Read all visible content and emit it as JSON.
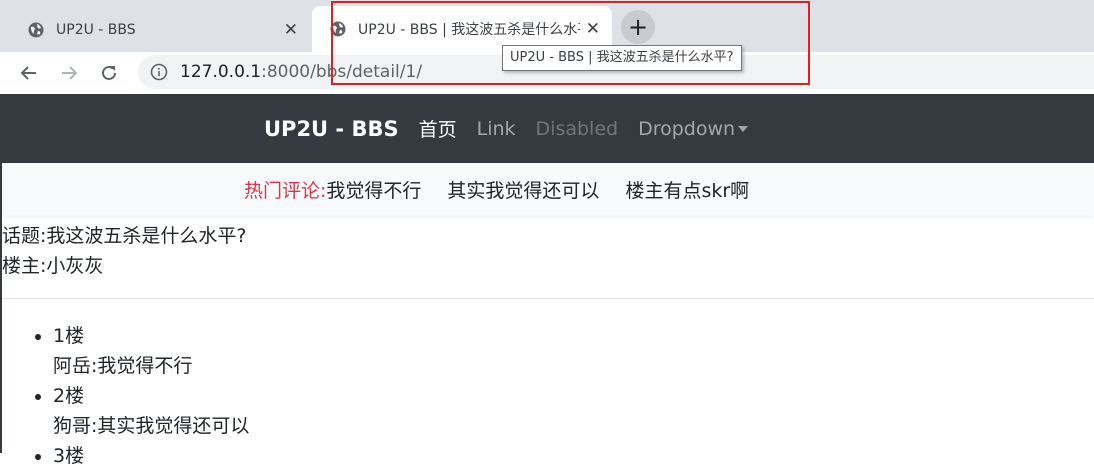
{
  "browser": {
    "tabs": [
      {
        "title": "UP2U - BBS",
        "icon": "globe-icon",
        "active": false
      },
      {
        "title": "UP2U - BBS | 我这波五杀是什么水平?",
        "icon": "globe-icon",
        "active": true
      }
    ],
    "new_tab_label": "+",
    "close_glyph": "✕",
    "tooltip": "UP2U - BBS | 我这波五杀是什么水平?",
    "url_host": "127.0.0.1",
    "url_path": ":8000/bbs/detail/1/",
    "highlight_color": "#e02020"
  },
  "navbar": {
    "brand": "UP2U - BBS",
    "links": [
      "首页",
      "Link",
      "Disabled",
      "Dropdown"
    ]
  },
  "hot": {
    "label": "热门评论:",
    "items": [
      "我觉得不行",
      "其实我觉得还可以",
      "楼主有点skr啊"
    ]
  },
  "topic": {
    "title_line": "话题:我这波五杀是什么水平?",
    "owner_line": "楼主:小灰灰"
  },
  "floors": [
    {
      "floor": "1楼",
      "content": "阿岳:我觉得不行"
    },
    {
      "floor": "2楼",
      "content": "狗哥:其实我觉得还可以"
    },
    {
      "floor": "3楼",
      "content": ""
    }
  ]
}
